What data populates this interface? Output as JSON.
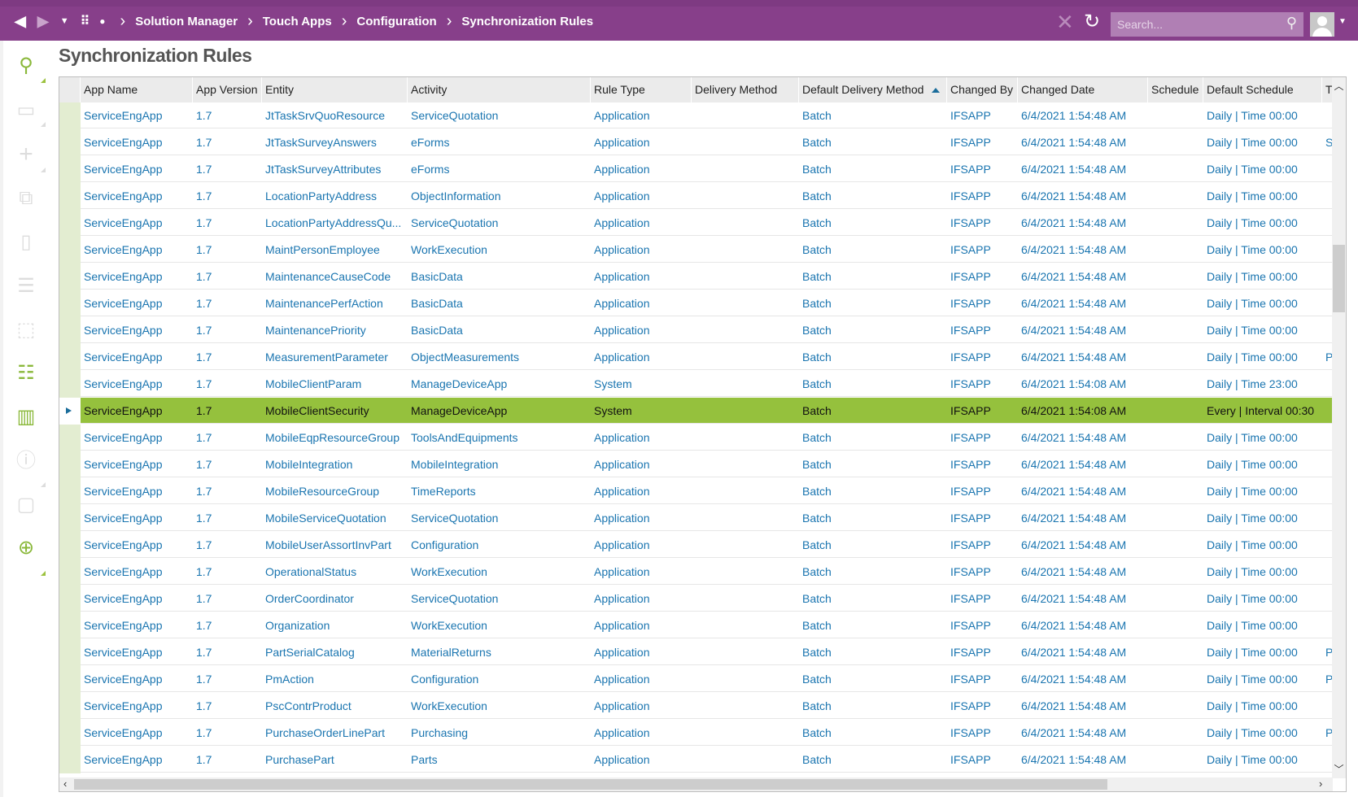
{
  "topbar": {
    "breadcrumb": [
      "Solution Manager",
      "Touch Apps",
      "Configuration",
      "Synchronization Rules"
    ],
    "search_placeholder": "Search...",
    "icons": [
      "back-icon",
      "forward-icon",
      "dropdown-icon",
      "apps-grid-icon",
      "dot-icon",
      "close-icon",
      "refresh-icon",
      "search-icon",
      "user-avatar-icon"
    ],
    "color": "#873f8a"
  },
  "page": {
    "title": "Synchronization Rules"
  },
  "sidebar": {
    "icons": [
      "search-icon",
      "save-icon",
      "new-icon",
      "duplicate-icon",
      "delete-icon",
      "list-icon",
      "open-details-icon",
      "details-list-icon",
      "chart-icon",
      "info-list-icon",
      "note-icon",
      "add-comment-icon"
    ]
  },
  "table": {
    "columns": [
      "App Name",
      "App Version",
      "Entity",
      "Activity",
      "Rule Type",
      "Delivery Method",
      "Default Delivery Method",
      "Changed By",
      "Changed Date",
      "Schedule",
      "Default Schedule",
      "T"
    ],
    "sorted_column": "Default Delivery Method",
    "sort_direction": "ascending",
    "selected_row": 11,
    "selected_color": "#95c13d",
    "rows": [
      [
        "ServiceEngApp",
        "1.7",
        "JtTaskSrvQuoResource",
        "ServiceQuotation",
        "Application",
        "",
        "Batch",
        "IFSAPP",
        "6/4/2021 1:54:48 AM",
        "",
        "Daily | Time 00:00",
        ""
      ],
      [
        "ServiceEngApp",
        "1.7",
        "JtTaskSurveyAnswers",
        "eForms",
        "Application",
        "",
        "Batch",
        "IFSAPP",
        "6/4/2021 1:54:48 AM",
        "",
        "Daily | Time 00:00",
        "S"
      ],
      [
        "ServiceEngApp",
        "1.7",
        "JtTaskSurveyAttributes",
        "eForms",
        "Application",
        "",
        "Batch",
        "IFSAPP",
        "6/4/2021 1:54:48 AM",
        "",
        "Daily | Time 00:00",
        ""
      ],
      [
        "ServiceEngApp",
        "1.7",
        "LocationPartyAddress",
        "ObjectInformation",
        "Application",
        "",
        "Batch",
        "IFSAPP",
        "6/4/2021 1:54:48 AM",
        "",
        "Daily | Time 00:00",
        ""
      ],
      [
        "ServiceEngApp",
        "1.7",
        "LocationPartyAddressQu...",
        "ServiceQuotation",
        "Application",
        "",
        "Batch",
        "IFSAPP",
        "6/4/2021 1:54:48 AM",
        "",
        "Daily | Time 00:00",
        ""
      ],
      [
        "ServiceEngApp",
        "1.7",
        "MaintPersonEmployee",
        "WorkExecution",
        "Application",
        "",
        "Batch",
        "IFSAPP",
        "6/4/2021 1:54:48 AM",
        "",
        "Daily | Time 00:00",
        ""
      ],
      [
        "ServiceEngApp",
        "1.7",
        "MaintenanceCauseCode",
        "BasicData",
        "Application",
        "",
        "Batch",
        "IFSAPP",
        "6/4/2021 1:54:48 AM",
        "",
        "Daily | Time 00:00",
        ""
      ],
      [
        "ServiceEngApp",
        "1.7",
        "MaintenancePerfAction",
        "BasicData",
        "Application",
        "",
        "Batch",
        "IFSAPP",
        "6/4/2021 1:54:48 AM",
        "",
        "Daily | Time 00:00",
        ""
      ],
      [
        "ServiceEngApp",
        "1.7",
        "MaintenancePriority",
        "BasicData",
        "Application",
        "",
        "Batch",
        "IFSAPP",
        "6/4/2021 1:54:48 AM",
        "",
        "Daily | Time 00:00",
        ""
      ],
      [
        "ServiceEngApp",
        "1.7",
        "MeasurementParameter",
        "ObjectMeasurements",
        "Application",
        "",
        "Batch",
        "IFSAPP",
        "6/4/2021 1:54:48 AM",
        "",
        "Daily | Time 00:00",
        "P"
      ],
      [
        "ServiceEngApp",
        "1.7",
        "MobileClientParam",
        "ManageDeviceApp",
        "System",
        "",
        "Batch",
        "IFSAPP",
        "6/4/2021 1:54:08 AM",
        "",
        "Daily | Time 23:00",
        ""
      ],
      [
        "ServiceEngApp",
        "1.7",
        "MobileClientSecurity",
        "ManageDeviceApp",
        "System",
        "",
        "Batch",
        "IFSAPP",
        "6/4/2021 1:54:08 AM",
        "",
        "Every | Interval 00:30",
        ""
      ],
      [
        "ServiceEngApp",
        "1.7",
        "MobileEqpResourceGroup",
        "ToolsAndEquipments",
        "Application",
        "",
        "Batch",
        "IFSAPP",
        "6/4/2021 1:54:48 AM",
        "",
        "Daily | Time 00:00",
        ""
      ],
      [
        "ServiceEngApp",
        "1.7",
        "MobileIntegration",
        "MobileIntegration",
        "Application",
        "",
        "Batch",
        "IFSAPP",
        "6/4/2021 1:54:48 AM",
        "",
        "Daily | Time 00:00",
        ""
      ],
      [
        "ServiceEngApp",
        "1.7",
        "MobileResourceGroup",
        "TimeReports",
        "Application",
        "",
        "Batch",
        "IFSAPP",
        "6/4/2021 1:54:48 AM",
        "",
        "Daily | Time 00:00",
        ""
      ],
      [
        "ServiceEngApp",
        "1.7",
        "MobileServiceQuotation",
        "ServiceQuotation",
        "Application",
        "",
        "Batch",
        "IFSAPP",
        "6/4/2021 1:54:48 AM",
        "",
        "Daily | Time 00:00",
        ""
      ],
      [
        "ServiceEngApp",
        "1.7",
        "MobileUserAssortInvPart",
        "Configuration",
        "Application",
        "",
        "Batch",
        "IFSAPP",
        "6/4/2021 1:54:48 AM",
        "",
        "Daily | Time 00:00",
        ""
      ],
      [
        "ServiceEngApp",
        "1.7",
        "OperationalStatus",
        "WorkExecution",
        "Application",
        "",
        "Batch",
        "IFSAPP",
        "6/4/2021 1:54:48 AM",
        "",
        "Daily | Time 00:00",
        ""
      ],
      [
        "ServiceEngApp",
        "1.7",
        "OrderCoordinator",
        "ServiceQuotation",
        "Application",
        "",
        "Batch",
        "IFSAPP",
        "6/4/2021 1:54:48 AM",
        "",
        "Daily | Time 00:00",
        ""
      ],
      [
        "ServiceEngApp",
        "1.7",
        "Organization",
        "WorkExecution",
        "Application",
        "",
        "Batch",
        "IFSAPP",
        "6/4/2021 1:54:48 AM",
        "",
        "Daily | Time 00:00",
        ""
      ],
      [
        "ServiceEngApp",
        "1.7",
        "PartSerialCatalog",
        "MaterialReturns",
        "Application",
        "",
        "Batch",
        "IFSAPP",
        "6/4/2021 1:54:48 AM",
        "",
        "Daily | Time 00:00",
        "P"
      ],
      [
        "ServiceEngApp",
        "1.7",
        "PmAction",
        "Configuration",
        "Application",
        "",
        "Batch",
        "IFSAPP",
        "6/4/2021 1:54:48 AM",
        "",
        "Daily | Time 00:00",
        "P"
      ],
      [
        "ServiceEngApp",
        "1.7",
        "PscContrProduct",
        "WorkExecution",
        "Application",
        "",
        "Batch",
        "IFSAPP",
        "6/4/2021 1:54:48 AM",
        "",
        "Daily | Time 00:00",
        ""
      ],
      [
        "ServiceEngApp",
        "1.7",
        "PurchaseOrderLinePart",
        "Purchasing",
        "Application",
        "",
        "Batch",
        "IFSAPP",
        "6/4/2021 1:54:48 AM",
        "",
        "Daily | Time 00:00",
        "P"
      ],
      [
        "ServiceEngApp",
        "1.7",
        "PurchasePart",
        "Parts",
        "Application",
        "",
        "Batch",
        "IFSAPP",
        "6/4/2021 1:54:48 AM",
        "",
        "Daily | Time 00:00",
        ""
      ]
    ]
  }
}
